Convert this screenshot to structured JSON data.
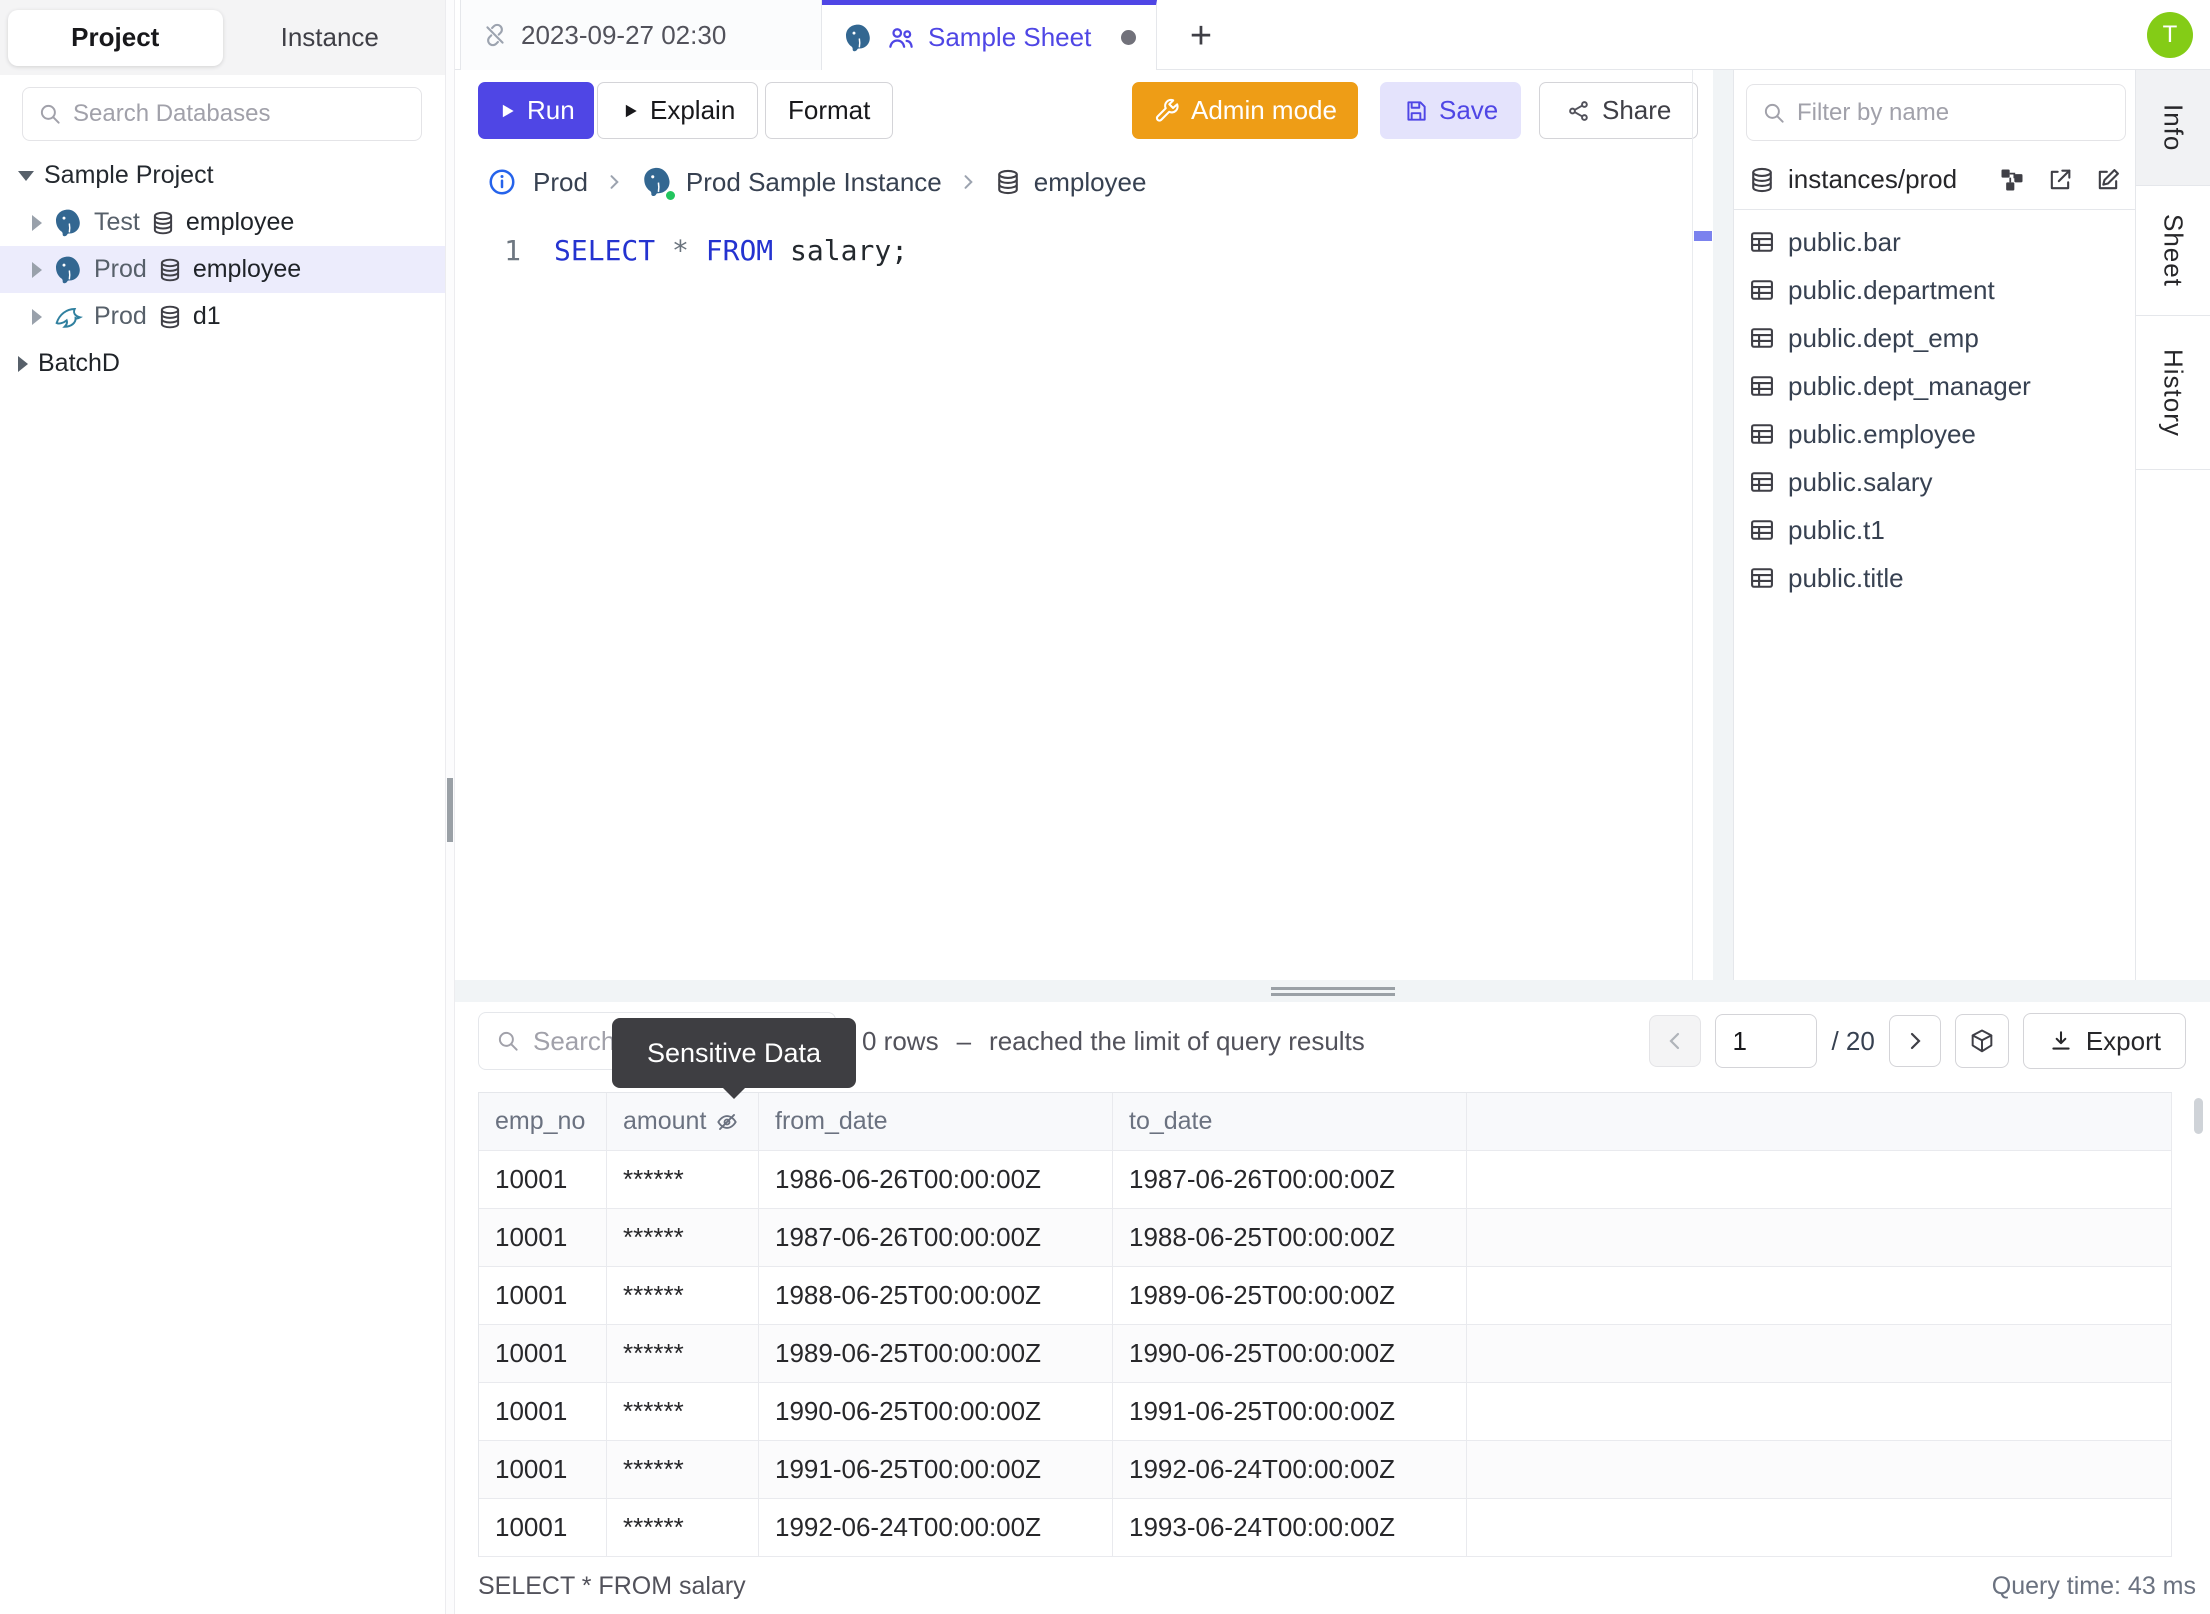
{
  "colors": {
    "accent": "#4f46e5",
    "accent_soft": "#e4e3fc",
    "selected_row": "#ececfc",
    "admin_orange": "#ee9d16",
    "avatar_green": "#84cc16",
    "connection_green": "#22c55e",
    "tooltip_bg": "#3e3e42",
    "postgres_blue": "#336791",
    "mysql_teal": "#30809f",
    "sql_keyword_blue": "#2433d0"
  },
  "sidebar": {
    "tabs": [
      {
        "label": "Project",
        "active": true
      },
      {
        "label": "Instance",
        "active": false
      }
    ],
    "search_placeholder": "Search Databases",
    "tree": {
      "project_label": "Sample Project",
      "rows": [
        {
          "env": "Test",
          "db": "employee",
          "engine": "postgres",
          "selected": false
        },
        {
          "env": "Prod",
          "db": "employee",
          "engine": "postgres",
          "selected": true
        },
        {
          "env": "Prod",
          "db": "d1",
          "engine": "mysql",
          "selected": false
        }
      ],
      "batch_label": "BatchD"
    }
  },
  "header": {
    "tabs": [
      {
        "label": "2023-09-27 02:30",
        "icon": "unlink"
      },
      {
        "label": "Sample Sheet",
        "icons": [
          "postgres",
          "team"
        ],
        "active": true,
        "unsaved": true
      }
    ],
    "new_tab_label": "+",
    "avatar_initial": "T"
  },
  "toolbar": {
    "run_label": "Run",
    "explain_label": "Explain",
    "format_label": "Format",
    "admin_mode_label": "Admin mode",
    "save_label": "Save",
    "share_label": "Share"
  },
  "breadcrumb": {
    "environment": "Prod",
    "instance": "Prod Sample Instance",
    "database": "employee"
  },
  "editor": {
    "line_number": "1",
    "sql": {
      "kw_select": "SELECT",
      "star": "*",
      "kw_from": "FROM",
      "rest": "salary;"
    }
  },
  "schema_panel": {
    "filter_placeholder": "Filter by name",
    "header_label": "instances/prod",
    "tables": [
      "public.bar",
      "public.department",
      "public.dept_emp",
      "public.dept_manager",
      "public.employee",
      "public.salary",
      "public.t1",
      "public.title"
    ]
  },
  "side_tabs": [
    {
      "label": "Info",
      "active": true
    },
    {
      "label": "Sheet",
      "active": false
    },
    {
      "label": "History",
      "active": false
    }
  ],
  "results": {
    "search_placeholder": "Search",
    "tooltip": "Sensitive Data",
    "rows_count": "0 rows",
    "dash": "–",
    "limit_message": "reached the limit of query results",
    "pagination": {
      "current": "1",
      "total": "/ 20"
    },
    "export_label": "Export",
    "columns": [
      "emp_no",
      "amount",
      "from_date",
      "to_date"
    ],
    "masked_column": "amount",
    "rows": [
      [
        "10001",
        "******",
        "1986-06-26T00:00:00Z",
        "1987-06-26T00:00:00Z"
      ],
      [
        "10001",
        "******",
        "1987-06-26T00:00:00Z",
        "1988-06-25T00:00:00Z"
      ],
      [
        "10001",
        "******",
        "1988-06-25T00:00:00Z",
        "1989-06-25T00:00:00Z"
      ],
      [
        "10001",
        "******",
        "1989-06-25T00:00:00Z",
        "1990-06-25T00:00:00Z"
      ],
      [
        "10001",
        "******",
        "1990-06-25T00:00:00Z",
        "1991-06-25T00:00:00Z"
      ],
      [
        "10001",
        "******",
        "1991-06-25T00:00:00Z",
        "1992-06-24T00:00:00Z"
      ],
      [
        "10001",
        "******",
        "1992-06-24T00:00:00Z",
        "1993-06-24T00:00:00Z"
      ]
    ],
    "status_left": "SELECT * FROM salary",
    "status_right": "Query time: 43 ms"
  }
}
